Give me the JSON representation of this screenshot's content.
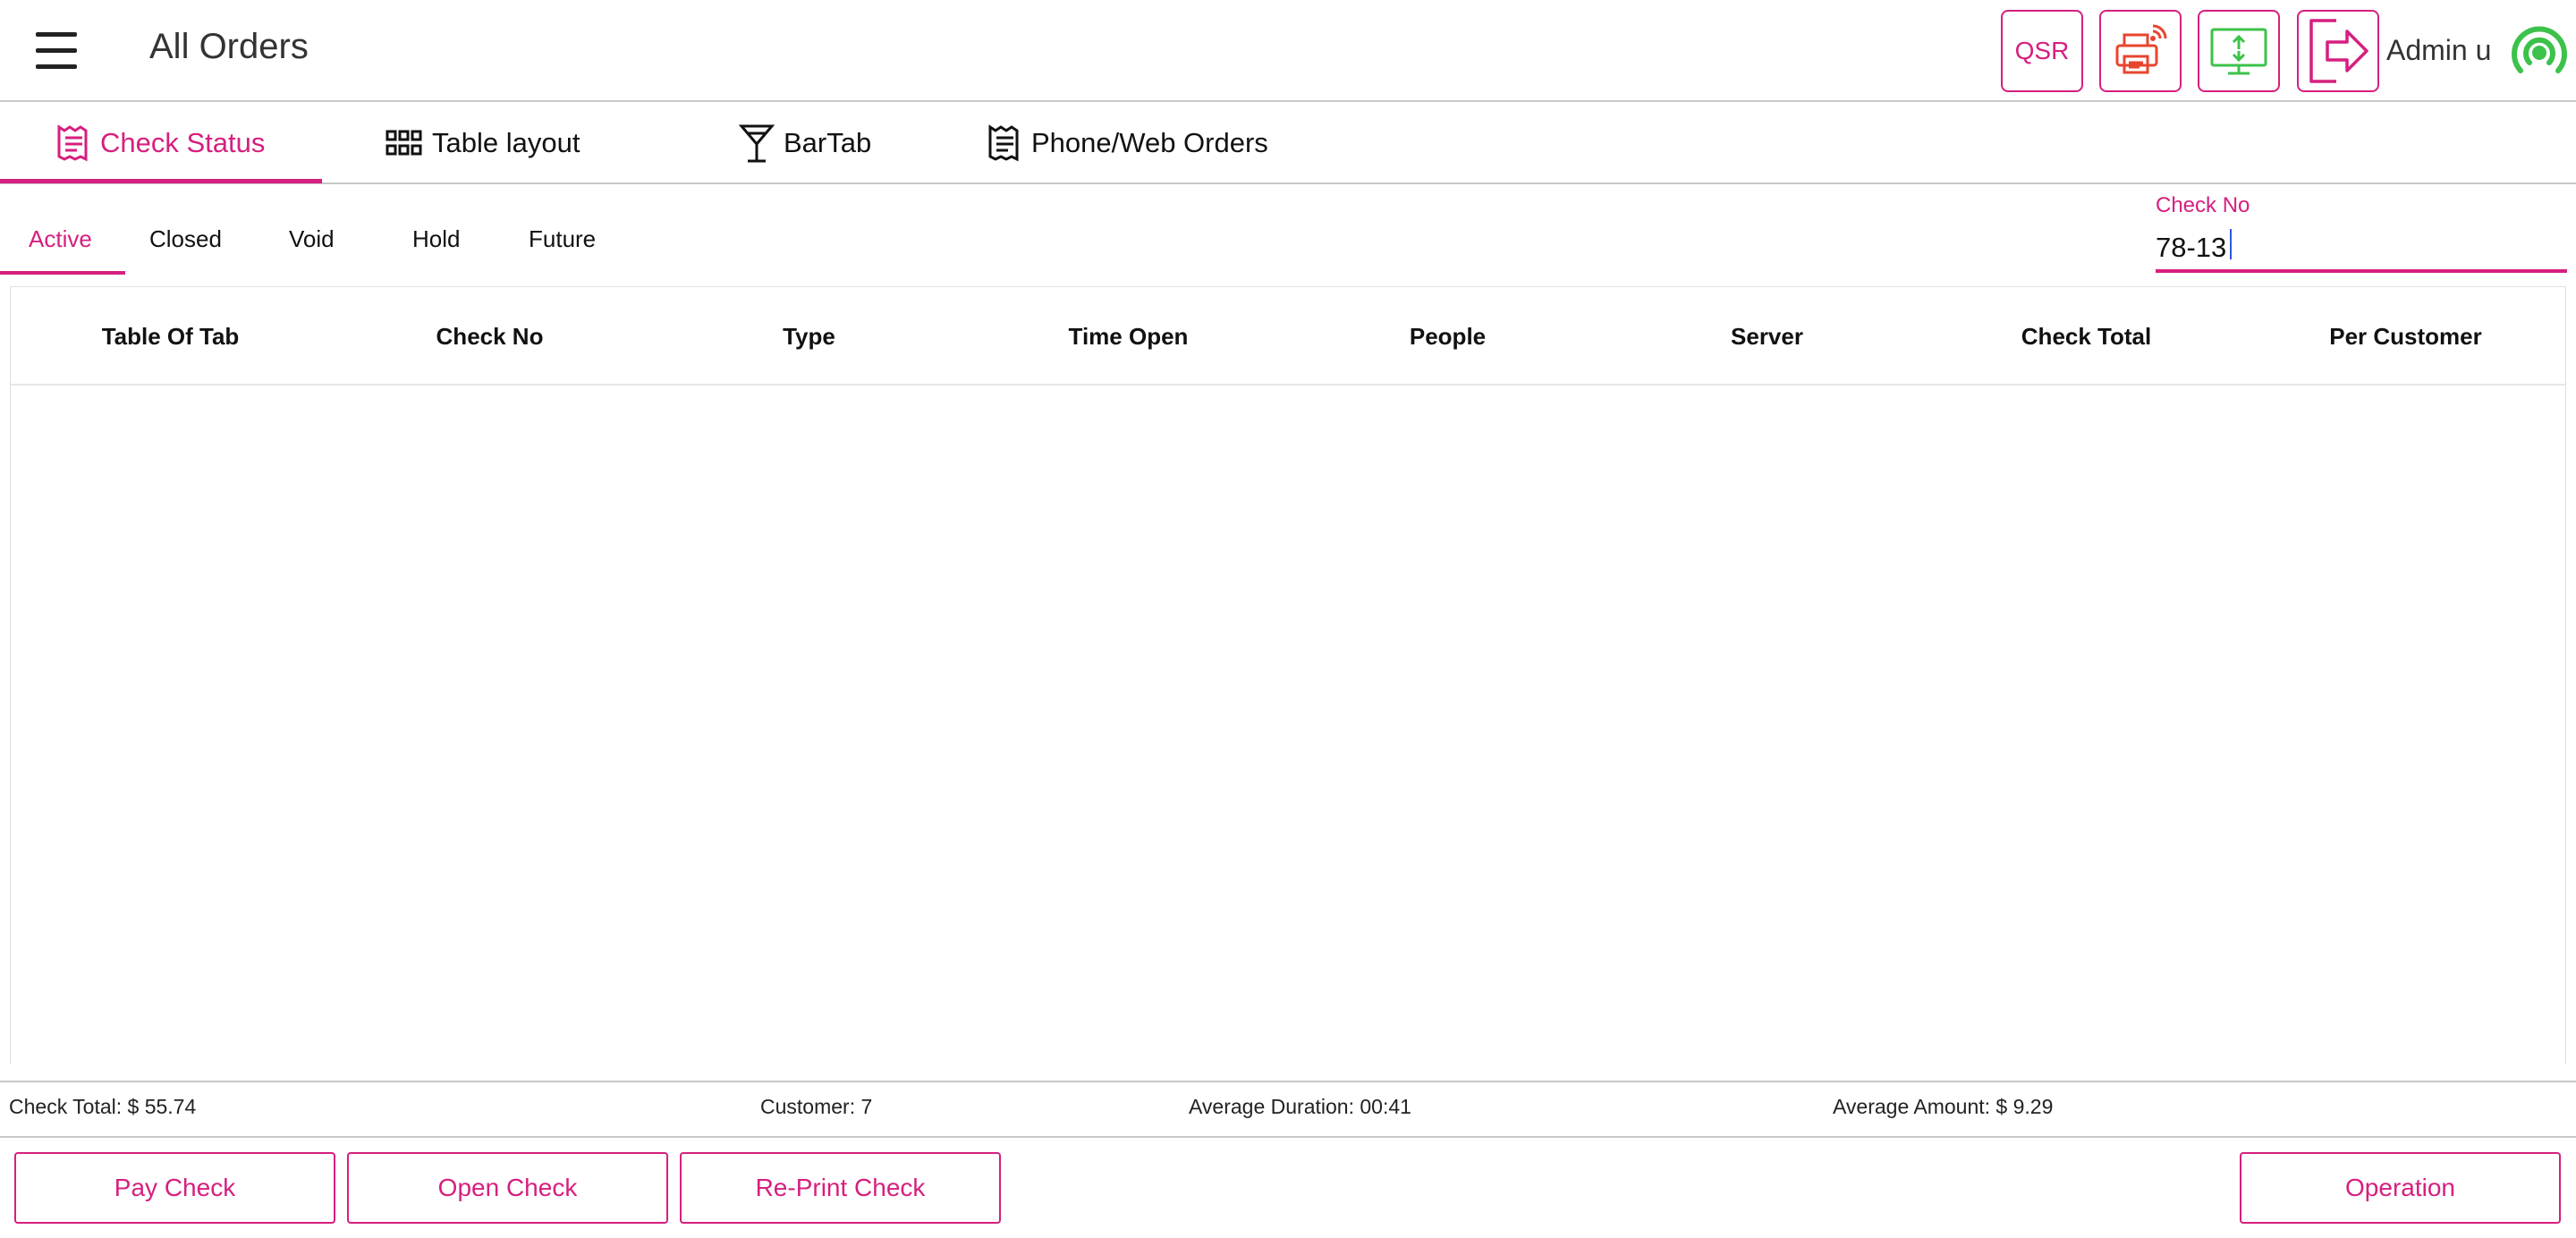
{
  "header": {
    "title": "All Orders",
    "qsr_label": "QSR",
    "user_name": "Admin u"
  },
  "tabs": [
    {
      "label": "Check Status",
      "icon": "receipt-icon",
      "active": true
    },
    {
      "label": "Table layout",
      "icon": "grid-icon",
      "active": false
    },
    {
      "label": "BarTab",
      "icon": "cocktail-glass-icon",
      "active": false
    },
    {
      "label": "Phone/Web Orders",
      "icon": "receipt-icon",
      "active": false
    }
  ],
  "filters": [
    {
      "label": "Active",
      "active": true
    },
    {
      "label": "Closed",
      "active": false
    },
    {
      "label": "Void",
      "active": false
    },
    {
      "label": "Hold",
      "active": false
    },
    {
      "label": "Future",
      "active": false
    }
  ],
  "search": {
    "label": "Check No",
    "value": "78-13"
  },
  "table": {
    "columns": [
      "Table Of Tab",
      "Check No",
      "Type",
      "Time Open",
      "People",
      "Server",
      "Check Total",
      "Per Customer"
    ],
    "rows": []
  },
  "summary": {
    "check_total": "Check Total: $ 55.74",
    "customer": "Customer: 7",
    "average_duration": "Average Duration: 00:41",
    "average_amount": "Average Amount: $ 9.29"
  },
  "footer": {
    "pay_check": "Pay Check",
    "open_check": "Open Check",
    "reprint_check": "Re-Print Check",
    "operation": "Operation"
  },
  "colors": {
    "accent": "#d61f7f",
    "printer": "#e8452f",
    "screen": "#3cc24a",
    "signal": "#3cc24a"
  }
}
